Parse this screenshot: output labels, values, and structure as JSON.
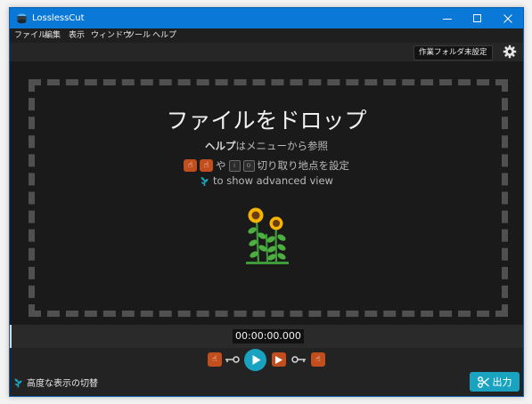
{
  "window": {
    "title": "LosslessCut"
  },
  "menu": {
    "items": [
      "ファイル",
      "編集",
      "表示",
      "ウィンドウ",
      "ツール",
      "ヘルプ"
    ]
  },
  "topbar": {
    "working_folder_label": "作業フォルダ未設定",
    "settings_icon": "gear-icon"
  },
  "drop_zone": {
    "title": "ファイルをドロップ",
    "help_bold": "ヘルプ",
    "help_rest": "はメニューから参照",
    "cut_connector": "や",
    "key_in": "I",
    "key_out": "O",
    "cut_text": "切り取り地点を設定",
    "advanced_text": "to show advanced view",
    "illustration": "sunflower-icon"
  },
  "timeline": {
    "timecode": "00:00:00.000"
  },
  "controls": {
    "advanced_toggle_label": "高度な表示の切替",
    "export_label": "出力"
  },
  "colors": {
    "titlebar": "#0a78d7",
    "background": "#1a1a1a",
    "accent": "#1aa3c0",
    "cut_button": "#c14e1c"
  }
}
